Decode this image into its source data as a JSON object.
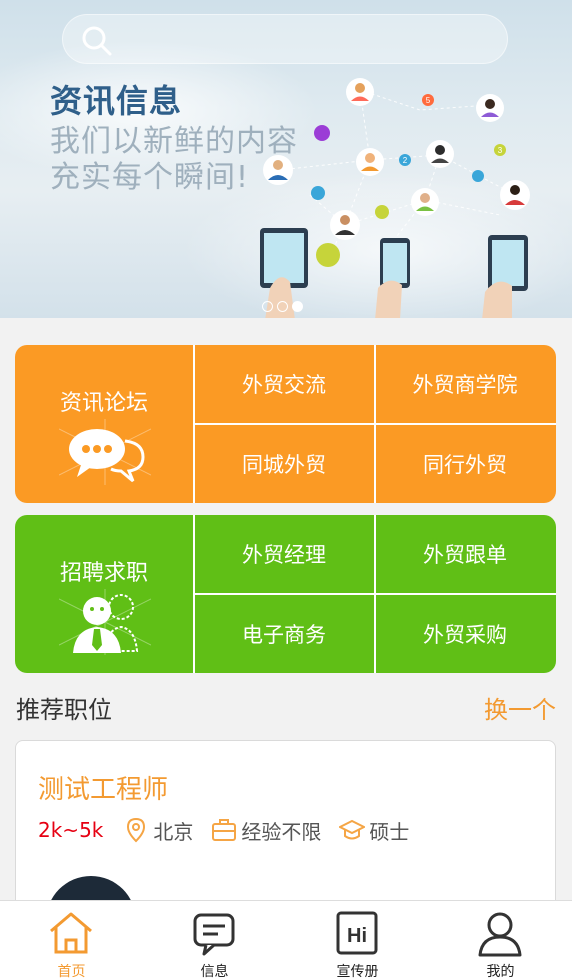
{
  "banner": {
    "title": "资讯信息",
    "subtitle_line1": "我们以新鲜的内容",
    "subtitle_line2": "充实每个瞬间!",
    "slide_count": 3,
    "active_slide": 3
  },
  "categories": [
    {
      "name": "资讯论坛",
      "color": "#fb9a24",
      "items": [
        "外贸交流",
        "外贸商学院",
        "同城外贸",
        "同行外贸"
      ]
    },
    {
      "name": "招聘求职",
      "color": "#60bf16",
      "items": [
        "外贸经理",
        "外贸跟单",
        "电子商务",
        "外贸采购"
      ]
    }
  ],
  "recommend": {
    "title": "推荐职位",
    "change_label": "换一个"
  },
  "job": {
    "title": "测试工程师",
    "salary": "2k~5k",
    "location": "北京",
    "experience": "经验不限",
    "education": "硕士"
  },
  "tabbar": {
    "tabs": [
      {
        "label": "首页",
        "icon": "home-icon",
        "active": true
      },
      {
        "label": "信息",
        "icon": "message-icon",
        "active": false
      },
      {
        "label": "宣传册",
        "icon": "brochure-icon",
        "active": false
      },
      {
        "label": "我的",
        "icon": "user-icon",
        "active": false
      }
    ]
  },
  "colors": {
    "accent": "#f39a31",
    "salary": "#e60012",
    "orange_block": "#fb9a24",
    "green_block": "#60bf16"
  }
}
